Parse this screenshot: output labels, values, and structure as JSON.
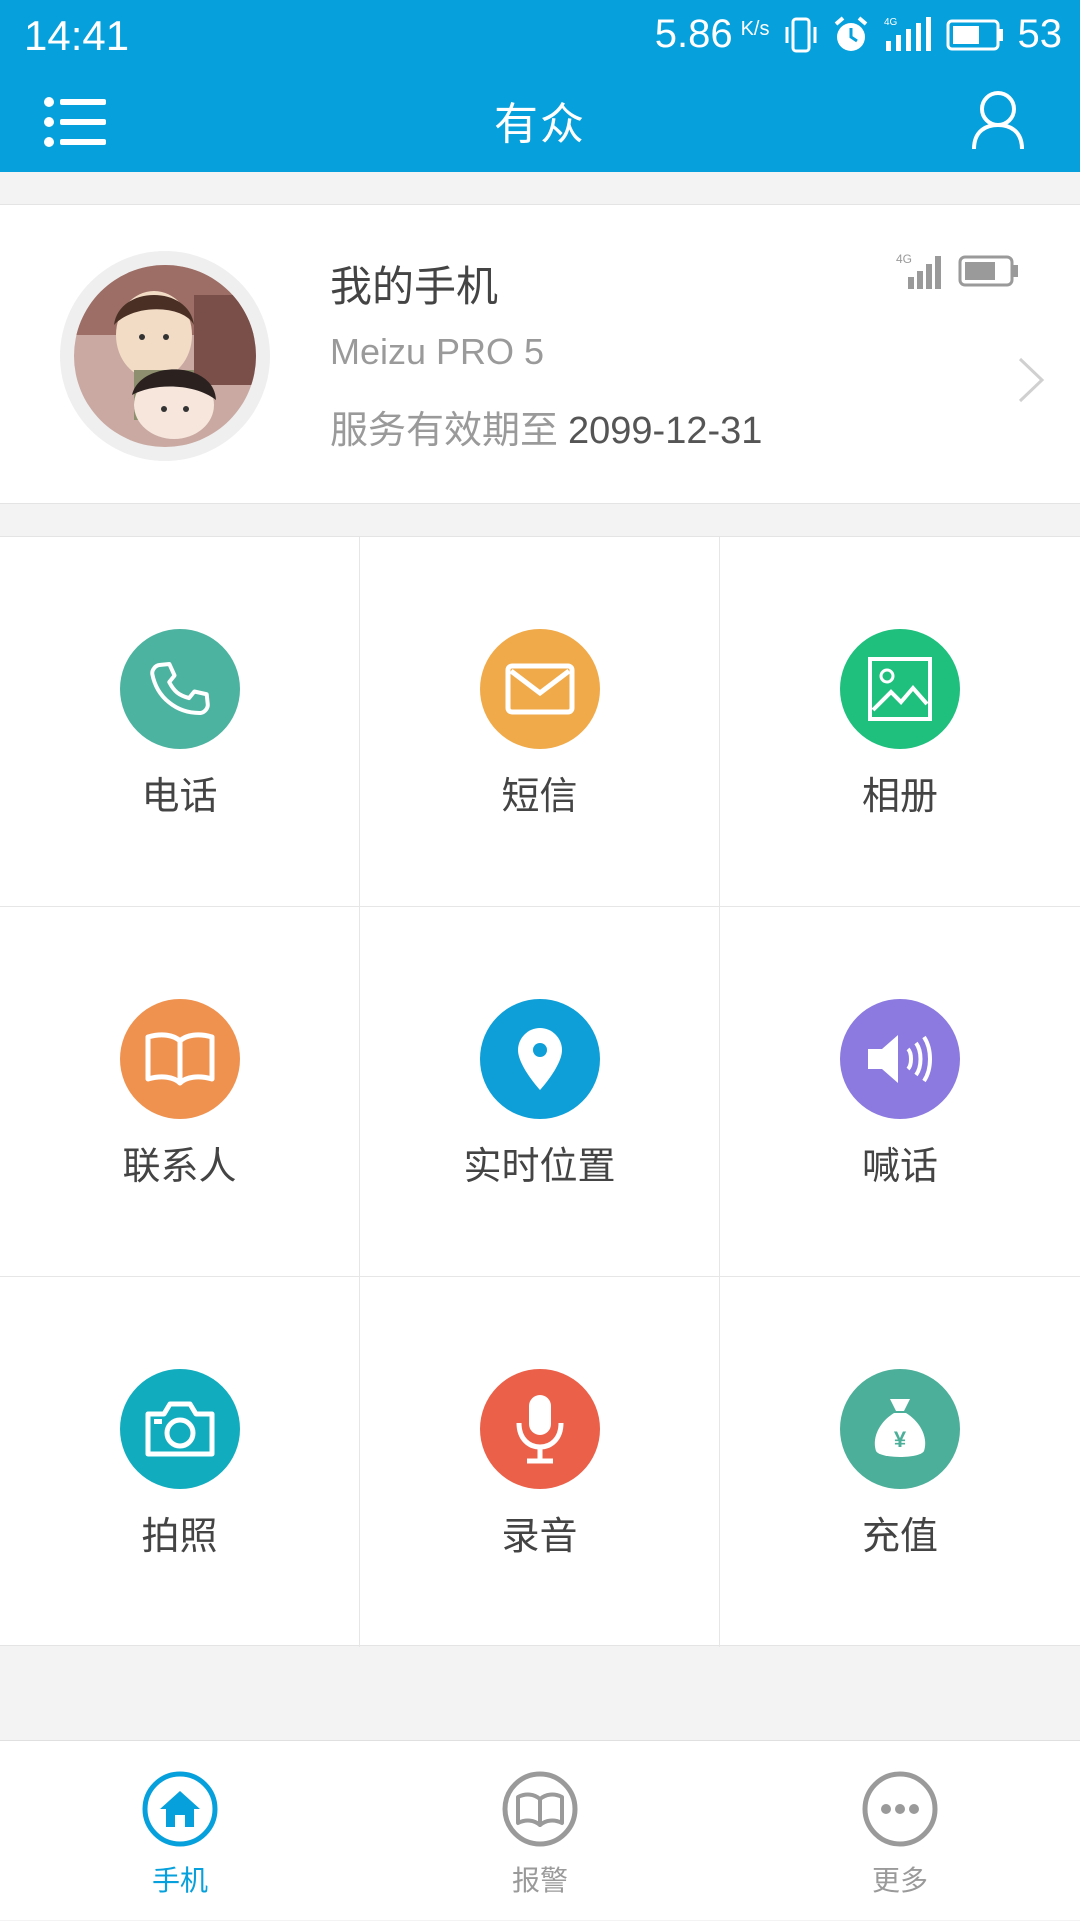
{
  "status_bar": {
    "time": "14:41",
    "speed": "5.86",
    "speed_unit": "K/s",
    "battery": "53"
  },
  "header": {
    "title": "有众",
    "menu_icon": "list-menu-icon",
    "user_icon": "user-icon"
  },
  "device": {
    "name": "我的手机",
    "model": "Meizu PRO 5",
    "expiry_label": "服务有效期至",
    "expiry_date": "2099-12-31",
    "network": "4G"
  },
  "features": [
    {
      "label": "电话",
      "icon": "phone-icon",
      "color": "#4cb3a0"
    },
    {
      "label": "短信",
      "icon": "mail-icon",
      "color": "#f0aa4a"
    },
    {
      "label": "相册",
      "icon": "photo-album-icon",
      "color": "#1fbf7e"
    },
    {
      "label": "联系人",
      "icon": "book-icon",
      "color": "#ef9250"
    },
    {
      "label": "实时位置",
      "icon": "location-pin-icon",
      "color": "#0e9fd8"
    },
    {
      "label": "喊话",
      "icon": "speaker-icon",
      "color": "#8c7ae0"
    },
    {
      "label": "拍照",
      "icon": "camera-icon",
      "color": "#12acbf"
    },
    {
      "label": "录音",
      "icon": "microphone-icon",
      "color": "#eb6049"
    },
    {
      "label": "充值",
      "icon": "money-bag-icon",
      "color": "#4caf99"
    }
  ],
  "tabs": [
    {
      "label": "手机",
      "icon": "home-icon",
      "active": true
    },
    {
      "label": "报警",
      "icon": "alarm-book-icon",
      "active": false
    },
    {
      "label": "更多",
      "icon": "more-dots-icon",
      "active": false
    }
  ],
  "colors": {
    "primary": "#06a0dc",
    "inactive": "#9a9a9a"
  }
}
